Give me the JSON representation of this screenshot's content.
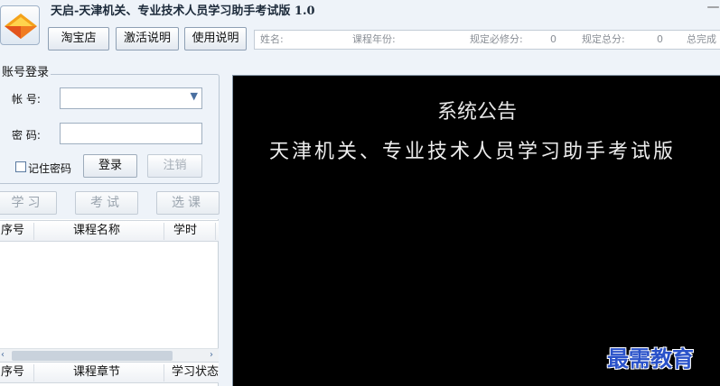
{
  "app": {
    "title": "天启-天津机关、专业技术人员学习助手考试版 1.0",
    "icon": "logo-diamond-icon",
    "minimize_label": "—"
  },
  "toolbar": {
    "taobao_label": "淘宝店",
    "activate_label": "激活说明",
    "help_label": "使用说明"
  },
  "infobar": {
    "name_label": "姓名:",
    "year_label": "课程年份:",
    "required_label": "规定必修分:",
    "required_value": "0",
    "total_label": "规定总分:",
    "total_value": "0",
    "completed_label": "总完成"
  },
  "login": {
    "group_title": "账号登录",
    "account_label": "帐  号:",
    "account_value": "",
    "password_label": "密  码:",
    "password_value": "",
    "remember_label": "记住密码",
    "login_label": "登录",
    "logout_label": "注销"
  },
  "actions": {
    "study_label": "学习",
    "exam_label": "考试",
    "select_label": "选课"
  },
  "course_table": {
    "columns": [
      "序号",
      "课程名称",
      "学时"
    ],
    "rows": []
  },
  "chapter_table": {
    "columns": [
      "序号",
      "课程章节",
      "学习状态"
    ],
    "rows": []
  },
  "scroll": {
    "left_arrow": "‹",
    "right_arrow": "›"
  },
  "notice": {
    "title": "系统公告",
    "line1": "天津机关、专业技术人员学习助手考试版"
  },
  "watermark": {
    "text": "最需教育"
  },
  "colors": {
    "window_bg": "#eef3f9",
    "notice_bg": "#000000",
    "watermark": "#2a52c9"
  }
}
